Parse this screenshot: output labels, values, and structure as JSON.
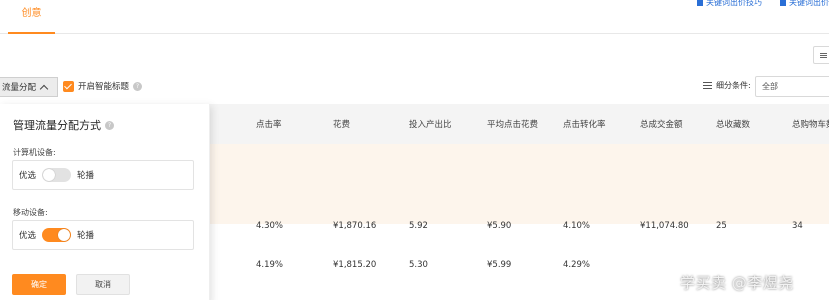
{
  "tabs": {
    "active_label": "创意"
  },
  "top_links": [
    {
      "label": "关键词出价技巧"
    },
    {
      "label": "关键词出价"
    }
  ],
  "toolbar": {
    "flow_label": "流量分配",
    "smart_title_label": "开启智能标题",
    "filter_label": "细分条件:",
    "filter_value": "全部"
  },
  "table": {
    "headers": [
      "点击率",
      "花费",
      "投入产出比",
      "平均点击花费",
      "点击转化率",
      "总成交金额",
      "总收藏数",
      "总购物车数"
    ],
    "rows": [
      [
        "4.30%",
        "¥1,870.16",
        "5.92",
        "¥5.90",
        "4.10%",
        "¥11,074.80",
        "25",
        "34"
      ],
      [
        "4.19%",
        "¥1,815.20",
        "5.30",
        "¥5.99",
        "4.29%",
        "",
        "",
        ""
      ]
    ]
  },
  "panel": {
    "title": "管理流量分配方式",
    "computer_label": "计算机设备:",
    "computer_option_left": "优选",
    "computer_option_right": "轮播",
    "computer_toggle_on": false,
    "mobile_label": "移动设备:",
    "mobile_option_left": "优选",
    "mobile_option_right": "轮播",
    "mobile_toggle_on": true,
    "confirm_label": "确定",
    "cancel_label": "取消"
  },
  "watermark": "学买卖 @李煜尧",
  "colors": {
    "accent": "#ff8a1f",
    "link": "#2a6fd6",
    "highlight_row": "#fdf5ec"
  }
}
